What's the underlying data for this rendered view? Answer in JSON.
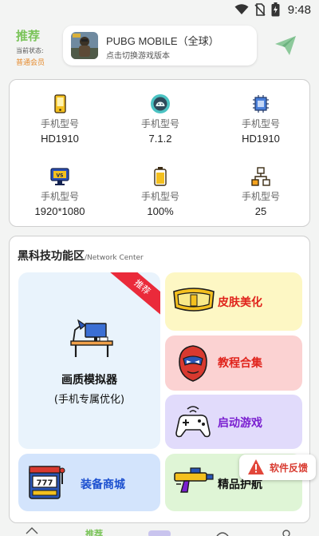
{
  "status_bar": {
    "time": "9:48",
    "icons": [
      "wifi-icon",
      "no-sim-icon",
      "battery-charging-icon"
    ]
  },
  "header": {
    "title": "推荐",
    "status_label": "当前状态:",
    "member_status": "普通会员",
    "game_card": {
      "name": "PUBG MOBILE（全球）",
      "subtitle": "点击切换游戏版本"
    },
    "send_icon": "send-icon"
  },
  "device_info": [
    {
      "icon": "phone-icon",
      "label": "手机型号",
      "value": "HD1910"
    },
    {
      "icon": "android-icon",
      "label": "手机型号",
      "value": "7.1.2"
    },
    {
      "icon": "cpu-icon",
      "label": "手机型号",
      "value": "HD1910"
    },
    {
      "icon": "monitor-icon",
      "label": "手机型号",
      "value": "1920*1080"
    },
    {
      "icon": "battery-icon",
      "label": "手机型号",
      "value": "100%"
    },
    {
      "icon": "network-icon",
      "label": "手机型号",
      "value": "25"
    }
  ],
  "features": {
    "title": "黑科技功能区",
    "subtitle": "/Network Center",
    "tiles": {
      "quality": {
        "line1": "画质模拟器",
        "line2": "(手机专属优化)",
        "badge": "推荐",
        "icon": "desk-lamp-icon"
      },
      "skin": {
        "label": "皮肤美化",
        "icon": "goggles-icon"
      },
      "tutorial": {
        "label": "教程合集",
        "icon": "hero-mask-icon"
      },
      "start_game": {
        "label": "启动游戏",
        "icon": "gamepad-icon"
      },
      "shop": {
        "label": "装备商城",
        "icon": "slot-machine-icon"
      },
      "elite": {
        "label": "精品护航",
        "icon": "blaster-icon"
      }
    },
    "colors": {
      "yellow_text": "#e0231c",
      "red_text": "#e0231c",
      "purple_text": "#7a1fd0",
      "blue_text": "#1b4fcf"
    }
  },
  "feedback": {
    "label": "软件反馈",
    "icon": "warning-icon"
  },
  "bottom_nav": [
    {
      "icon": "home-icon",
      "label": ""
    },
    {
      "icon": "recommend-icon",
      "label": "推荐"
    },
    {
      "icon": "apps-icon",
      "label": ""
    },
    {
      "icon": "chat-icon",
      "label": ""
    },
    {
      "icon": "profile-icon",
      "label": ""
    }
  ]
}
